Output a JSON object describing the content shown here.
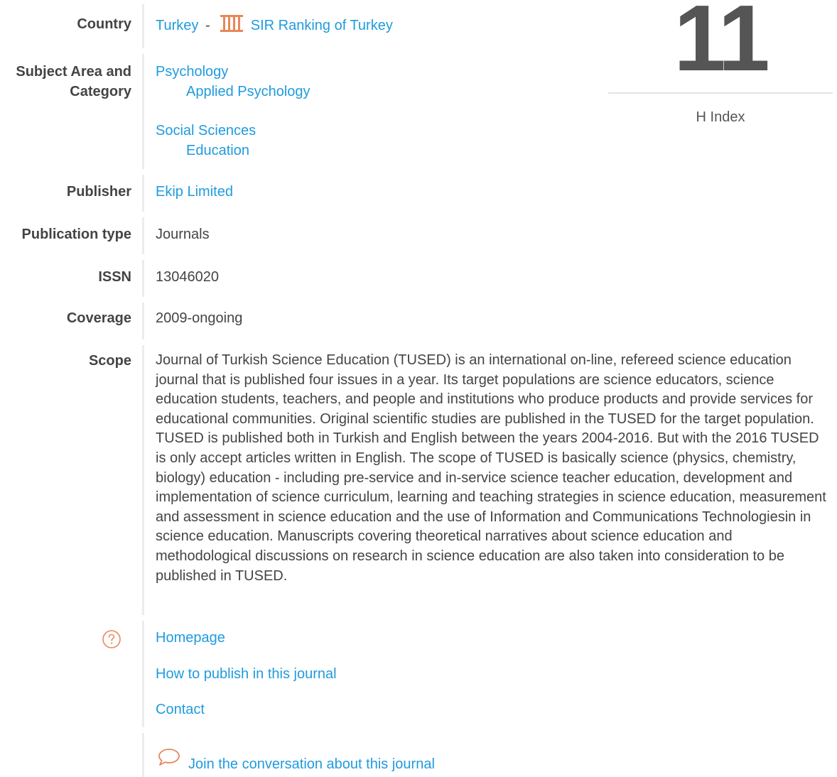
{
  "labels": {
    "country": "Country",
    "subject_area_line1": "Subject Area and",
    "subject_area_line2": "Category",
    "publisher": "Publisher",
    "publication_type": "Publication type",
    "issn": "ISSN",
    "coverage": "Coverage",
    "scope": "Scope"
  },
  "country": {
    "name": "Turkey",
    "separator": "-",
    "sir_link": "SIR Ranking of Turkey",
    "icon": "sir-ranking-icon"
  },
  "subjects": [
    {
      "area": "Psychology",
      "category": "Applied Psychology"
    },
    {
      "area": "Social Sciences",
      "category": "Education"
    }
  ],
  "publisher": "Ekip Limited",
  "publication_type": "Journals",
  "issn": "13046020",
  "coverage": "2009-ongoing",
  "scope": "Journal of Turkish Science Education (TUSED) is an international on-line, refereed science education journal that is published four issues in a year. Its target populations are science educators, science education students, teachers, and people and institutions who produce products and provide services for educational communities. Original scientific studies are published in the TUSED for the target population. TUSED is published both in Turkish and English between the years 2004-2016. But with the 2016 TUSED is only accept articles written in English. The scope of TUSED is basically science (physics, chemistry, biology) education - including pre-service and in-service science teacher education, development and implementation of science curriculum, learning and teaching strategies in science education, measurement and assessment in science education and the use of Information and Communications Technologiesin in science education. Manuscripts covering theoretical narratives about science education and methodological discussions on research in science education are also taken into consideration to be published in TUSED.",
  "links": {
    "homepage": "Homepage",
    "how_to_publish": "How to publish in this journal",
    "contact": "Contact"
  },
  "conversation": "Join the conversation about this journal",
  "hindex": {
    "value": "11",
    "label": "H Index"
  },
  "colors": {
    "link": "#1f9bde",
    "accent_icon": "#e8875a",
    "text": "#444444"
  }
}
